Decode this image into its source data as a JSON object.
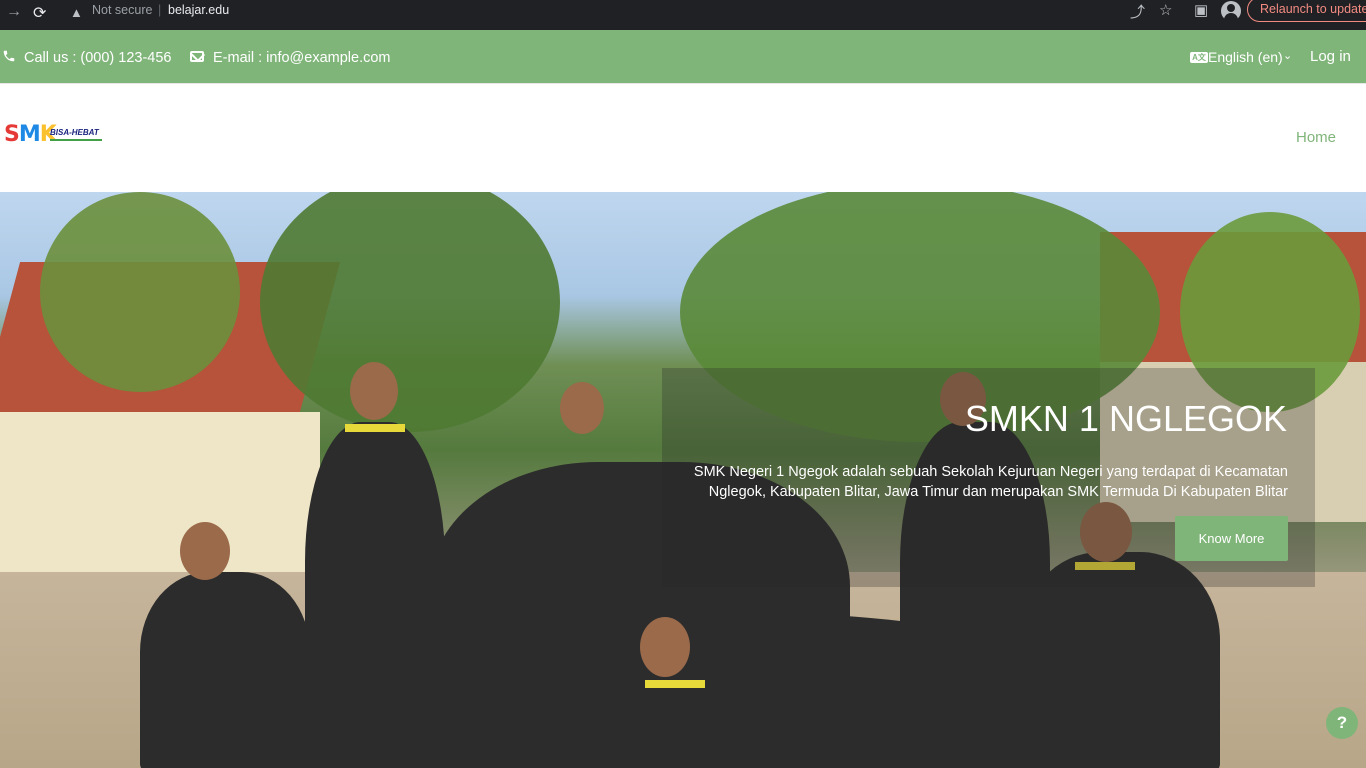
{
  "browser": {
    "security_label": "Not secure",
    "separator": "|",
    "url": "belajar.edu",
    "relaunch_label": "Relaunch to update"
  },
  "topbar": {
    "phone_text": "Call us : (000) 123-456",
    "email_text": "E-mail : info@example.com",
    "language_label": "English (en)",
    "language_caret": "⌄",
    "login_label": "Log in",
    "background_color": "#80b57a"
  },
  "header": {
    "logo_tagline": "BISA-HEBAT",
    "nav_home": "Home"
  },
  "hero": {
    "title": "SMKN 1 NGLEGOK",
    "description": "SMK Negeri 1 Ngegok adalah sebuah Sekolah Kejuruan Negeri yang terdapat di Kecamatan Nglegok, Kabupaten Blitar, Jawa Timur dan merupakan SMK Termuda Di Kabupaten Blitar",
    "button_label": "Know More"
  },
  "help": {
    "label": "?"
  },
  "icons": {
    "back": "arrow-right-icon",
    "reload": "reload-icon",
    "warning": "warning-icon",
    "share": "share-icon",
    "star": "star-icon",
    "sidebar": "sidebar-icon",
    "profile": "profile-icon",
    "phone": "phone-icon",
    "mail": "mail-icon",
    "language": "language-icon"
  },
  "accent_color": "#80b57a"
}
